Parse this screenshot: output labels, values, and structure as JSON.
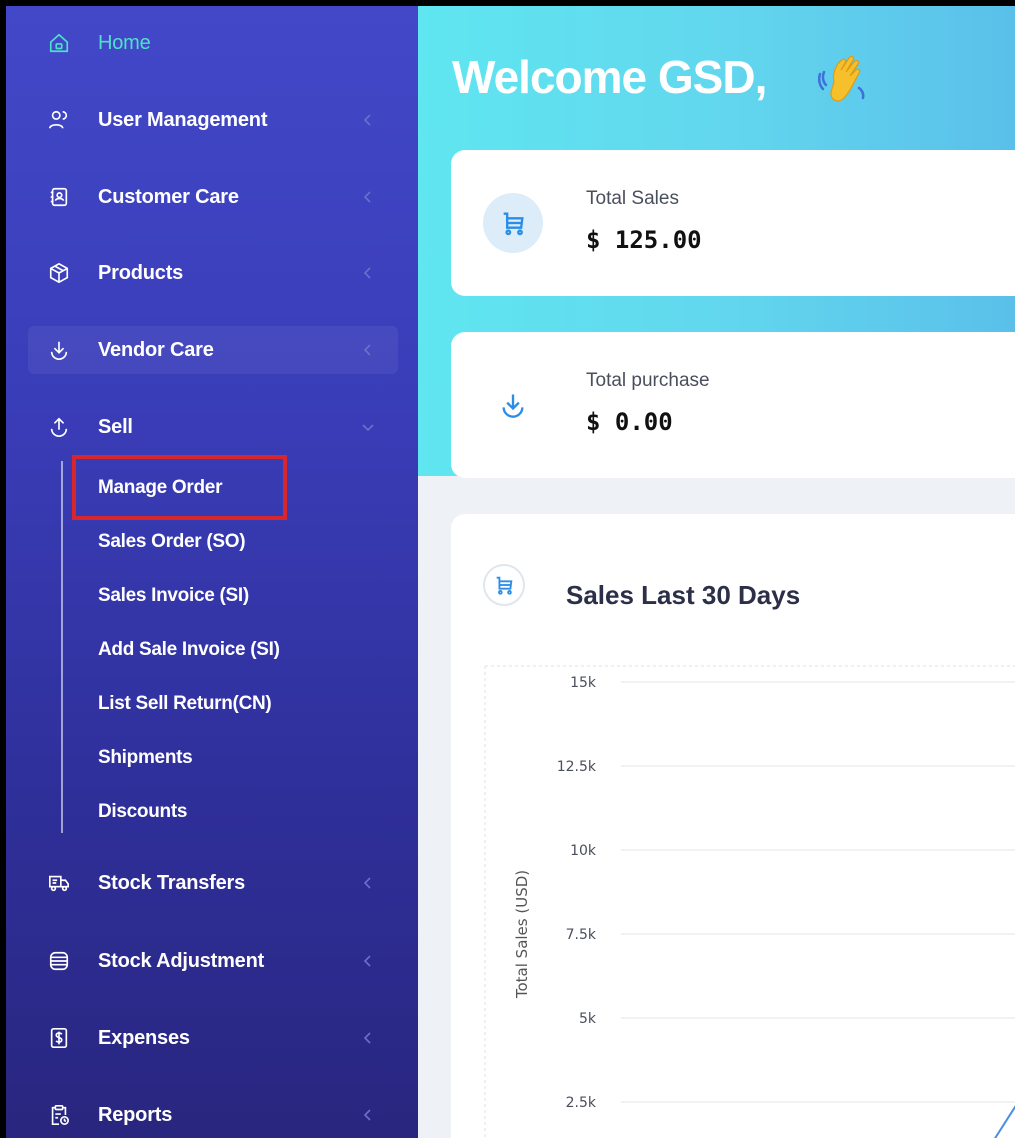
{
  "sidebar": {
    "items": [
      {
        "label": "Home",
        "icon": "home-icon"
      },
      {
        "label": "User Management",
        "icon": "users-icon"
      },
      {
        "label": "Customer Care",
        "icon": "contact-card-icon"
      },
      {
        "label": "Products",
        "icon": "box-icon"
      },
      {
        "label": "Vendor Care",
        "icon": "download-arrow-icon"
      },
      {
        "label": "Sell",
        "icon": "upload-arrow-icon"
      },
      {
        "label": "Stock Transfers",
        "icon": "truck-icon"
      },
      {
        "label": "Stock Adjustment",
        "icon": "database-icon"
      },
      {
        "label": "Expenses",
        "icon": "dollar-doc-icon"
      },
      {
        "label": "Reports",
        "icon": "clipboard-report-icon"
      }
    ],
    "sell_submenu": [
      "Manage Order",
      "Sales Order (SO)",
      "Sales Invoice (SI)",
      "Add Sale Invoice (SI)",
      "List Sell Return(CN)",
      "Shipments",
      "Discounts"
    ],
    "highlighted_item": "Manage Order",
    "colors": {
      "home_active": "#4fe0c9",
      "highlight_border": "#d7262c"
    }
  },
  "main": {
    "welcome": "Welcome GSD,",
    "wave_icon": "waving-hand-icon",
    "stats": [
      {
        "label": "Total Sales",
        "value": "$ 125.00",
        "icon": "cart-icon"
      },
      {
        "label": "Total purchase",
        "value": "$ 0.00",
        "icon": "download-arrow-icon"
      }
    ],
    "chart_title": "Sales Last 30 Days",
    "chart_icon": "cart-icon"
  },
  "chart_data": {
    "type": "line",
    "title": "Sales Last 30 Days",
    "ylabel": "Total Sales (USD)",
    "xlabel": "",
    "yticks": [
      "15k",
      "12.5k",
      "10k",
      "7.5k",
      "5k",
      "2.5k"
    ],
    "ylim": [
      0,
      15000
    ],
    "grid": true,
    "accent": "#4a8fe0"
  }
}
